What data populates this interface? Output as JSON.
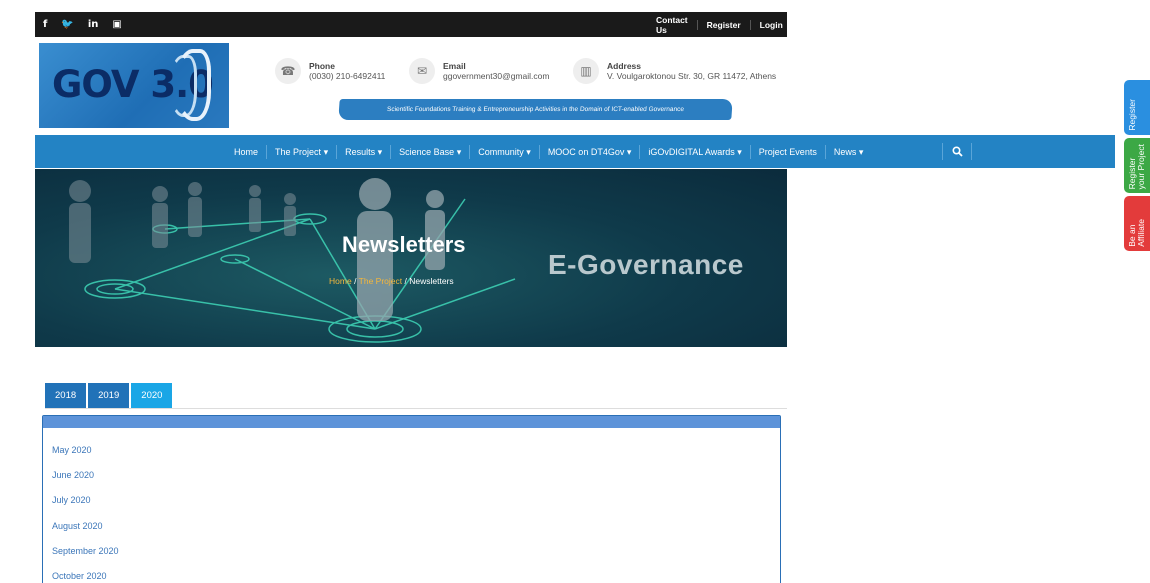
{
  "topbar": {
    "social": [
      "f",
      "y",
      "in",
      "yt"
    ],
    "links": [
      "Contact Us",
      "Register",
      "Login"
    ]
  },
  "logo": {
    "text": "GOV 3.0"
  },
  "contacts": {
    "phone": {
      "label": "Phone",
      "value": "(0030) 210-6492411"
    },
    "email": {
      "label": "Email",
      "value": "ggovernment30@gmail.com"
    },
    "address": {
      "label": "Address",
      "value": "V. Voulgaroktonou Str. 30, GR 11472, Athens"
    }
  },
  "banner": "Scientific Foundations Training & Entrepreneurship Activities in the Domain of ICT-enabled Governance",
  "nav": {
    "home": "Home",
    "project": "The Project",
    "results": "Results",
    "science": "Science Base",
    "community": "Community",
    "mooc": "MOOC on DT4Gov",
    "awards": "iGOvDIGITAL Awards",
    "events": "Project Events",
    "news": "News",
    "caret": "▾",
    "search_icon": "magnifier"
  },
  "hero": {
    "title": "Newsletters",
    "crumb_home": "Home",
    "crumb_project": "The Project",
    "crumb_current": "Newsletters",
    "sep": "/",
    "egov": "E-Governance"
  },
  "tabs": [
    "2018",
    "2019",
    "2020"
  ],
  "active_tab": "2020",
  "newsletters": [
    "May 2020",
    "June 2020",
    "July 2020",
    "August 2020",
    "September 2020",
    "October 2020"
  ],
  "side_tabs": {
    "register": "Register",
    "register_project": "Register",
    "register_project_sub": "your Project",
    "affiliate": "Be an",
    "affiliate_sub": "Affiliate"
  },
  "colors": {
    "nav": "#2383c4",
    "tab": "#2172b8",
    "tab_active": "#1aa6e6",
    "accent_link": "#f5b73b",
    "side_blue": "#2a8fe0",
    "side_green": "#3ca845",
    "side_red": "#e33b3b"
  }
}
